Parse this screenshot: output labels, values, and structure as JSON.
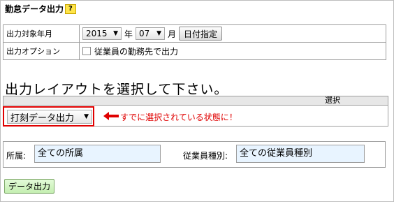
{
  "page": {
    "title": "勤怠データ出力",
    "help_label": "?"
  },
  "options": {
    "period_label": "出力対象年月",
    "year_value": "2015",
    "year_unit": "年",
    "month_value": "07",
    "month_unit": "月",
    "date_button": "日付指定",
    "option_label": "出力オプション",
    "checkbox_label": "従業員の勤務先で出力",
    "checkbox_checked": false
  },
  "layout": {
    "heading": "出力レイアウトを選択して下さい。",
    "column_header": "選択",
    "selected": "打刻データ出力",
    "annotation": "すでに選択されている状態に！",
    "annotation_color": "#e00000"
  },
  "filters": {
    "department_label": "所属:",
    "department_value": "全ての所属",
    "employee_type_label": "従業員種別:",
    "employee_type_value": "全ての従業員種別"
  },
  "actions": {
    "export_label": "データ出力"
  }
}
